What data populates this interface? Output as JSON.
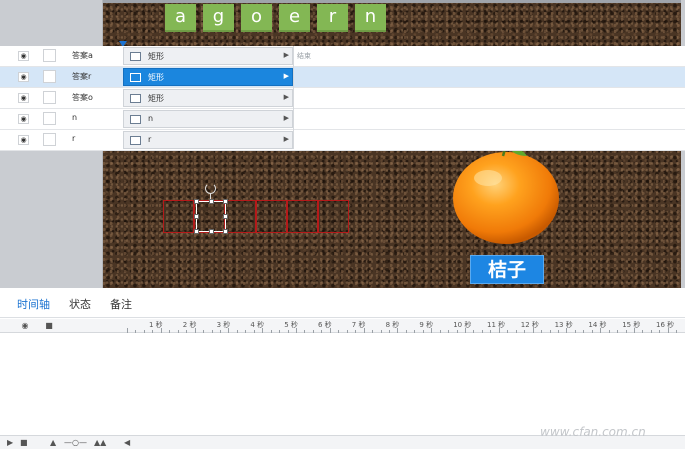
{
  "stage": {
    "letters": [
      "a",
      "g",
      "o",
      "e",
      "r",
      "n"
    ],
    "answer_slot_count": 6,
    "fruit_label": "桔子",
    "colors": {
      "letter_tile": "#83b754",
      "answer_border": "#b51a1a",
      "label_bg": "#1d86e3"
    }
  },
  "panel": {
    "tabs": [
      {
        "label": "时间轴",
        "active": true
      },
      {
        "label": "状态",
        "active": false
      },
      {
        "label": "备注",
        "active": false
      }
    ],
    "ruler": [
      "1 秒",
      "2 秒",
      "3 秒",
      "4 秒",
      "5 秒",
      "6 秒",
      "7 秒",
      "8 秒",
      "9 秒",
      "10 秒",
      "11 秒",
      "12 秒",
      "13 秒",
      "14 秒",
      "15 秒",
      "16 秒"
    ],
    "end_label": "结束",
    "rows": [
      {
        "name": "答案a",
        "bar_label": "矩形",
        "selected": false
      },
      {
        "name": "答案r",
        "bar_label": "矩形",
        "selected": true
      },
      {
        "name": "答案o",
        "bar_label": "矩形",
        "selected": false
      },
      {
        "name": "n",
        "bar_label": "n",
        "selected": false
      },
      {
        "name": "r",
        "bar_label": "r",
        "selected": false
      }
    ]
  },
  "watermark": "www.cfan.com.cn",
  "icons": [
    "eye-icon",
    "lock-icon",
    "rectangle-icon",
    "play-icon",
    "stop-icon",
    "zoom-slider-icon",
    "mountain-icon"
  ]
}
